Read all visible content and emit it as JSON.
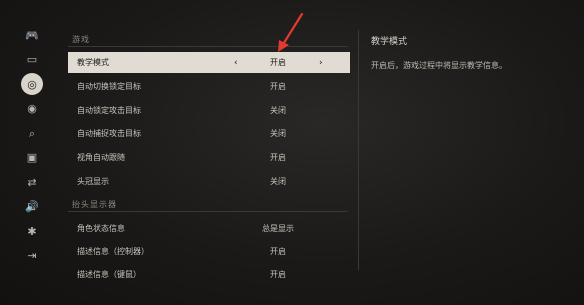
{
  "sidebar": {
    "icons": [
      "gamepad-icon",
      "display-icon",
      "target-icon",
      "eye-icon",
      "search-icon",
      "screen-icon",
      "swap-icon",
      "volume-icon",
      "accessibility-icon",
      "exit-icon"
    ],
    "glyphs": [
      "🎮",
      "▭",
      "◎",
      "◉",
      "⌕",
      "▣",
      "⇄",
      "🔊",
      "✱",
      "⇥"
    ],
    "active_index": 2
  },
  "sections": [
    {
      "header": "游戏",
      "rows": [
        {
          "label": "教学模式",
          "value": "开启",
          "selected": true
        },
        {
          "label": "自动切换锁定目标",
          "value": "开启"
        },
        {
          "label": "自动锁定攻击目标",
          "value": "关闭"
        },
        {
          "label": "自动捕捉攻击目标",
          "value": "关闭"
        },
        {
          "label": "视角自动跟随",
          "value": "开启"
        },
        {
          "label": "头冠显示",
          "value": "关闭"
        }
      ]
    },
    {
      "header": "抬头显示器",
      "rows": [
        {
          "label": "角色状态信息",
          "value": "总是显示"
        },
        {
          "label": "描述信息（控制器）",
          "value": "开启"
        },
        {
          "label": "描述信息（键鼠）",
          "value": "开启"
        }
      ]
    }
  ],
  "selector": {
    "left_arrow": "‹",
    "right_arrow": "›"
  },
  "detail": {
    "title": "教学模式",
    "text": "开启后，游戏过程中将显示教学信息。"
  },
  "colors": {
    "selected_bg": "#e0dcd4",
    "annotation_arrow": "#e23a2e"
  }
}
